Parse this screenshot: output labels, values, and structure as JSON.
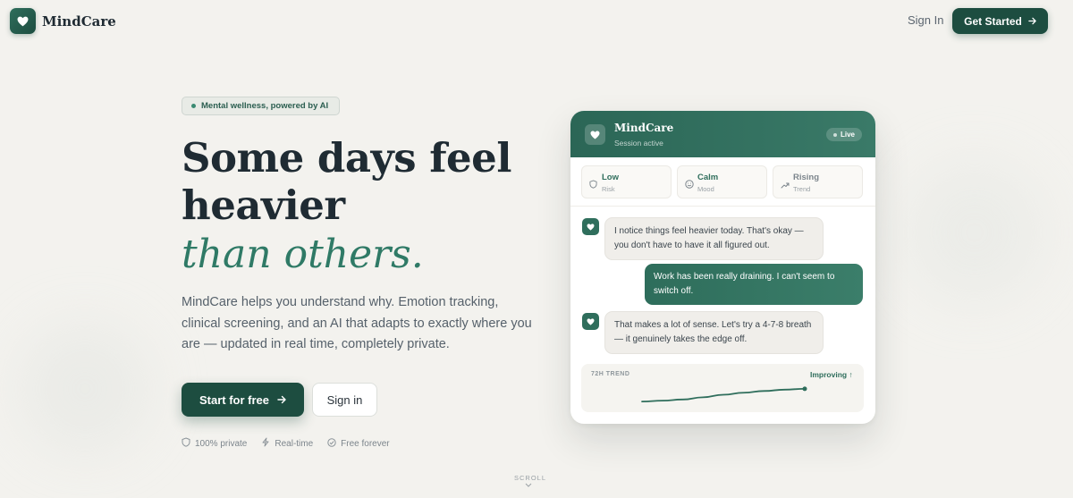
{
  "nav": {
    "brand": "MindCare",
    "signin": "Sign In",
    "cta": "Get Started"
  },
  "hero": {
    "badge": "Mental wellness, powered by AI",
    "headline_line1": "Some days feel",
    "headline_line2": "heavier",
    "headline_accent": "than others.",
    "lead": "MindCare helps you understand why. Emotion tracking, clinical screening, and an AI that adapts to exactly where you are — updated in real time, completely private.",
    "primary_cta": "Start for free",
    "secondary_cta": "Sign in",
    "features": [
      {
        "icon": "shield-icon",
        "label": "100% private"
      },
      {
        "icon": "bolt-icon",
        "label": "Real-time"
      },
      {
        "icon": "check-circle-icon",
        "label": "Free forever"
      }
    ],
    "scroll": "SCROLL"
  },
  "card": {
    "title": "MindCare",
    "subtitle": "Session active",
    "live": "Live",
    "stats": [
      {
        "icon": "shield-icon",
        "value": "Low",
        "label": "Risk"
      },
      {
        "icon": "smile-icon",
        "value": "Calm",
        "label": "Mood"
      },
      {
        "icon": "trend-icon",
        "value": "Rising",
        "label": "Trend"
      }
    ],
    "messages": [
      {
        "from": "ai",
        "text": "I notice things feel heavier today. That's okay — you don't have to have it all figured out."
      },
      {
        "from": "user",
        "text": "Work has been really draining. I can't seem to switch off."
      },
      {
        "from": "ai",
        "text": "That makes a lot of sense. Let's try a 4-7-8 breath — it genuinely takes the edge off."
      }
    ],
    "trend_label": "72H TREND",
    "trend_status": "Improving ↑",
    "trend_values": [
      0.1,
      0.15,
      0.22,
      0.35,
      0.5,
      0.62,
      0.72,
      0.8,
      0.85
    ]
  },
  "colors": {
    "accent": "#1d4d40",
    "accent_light": "#2f7a66",
    "background": "#f3f2ee"
  }
}
